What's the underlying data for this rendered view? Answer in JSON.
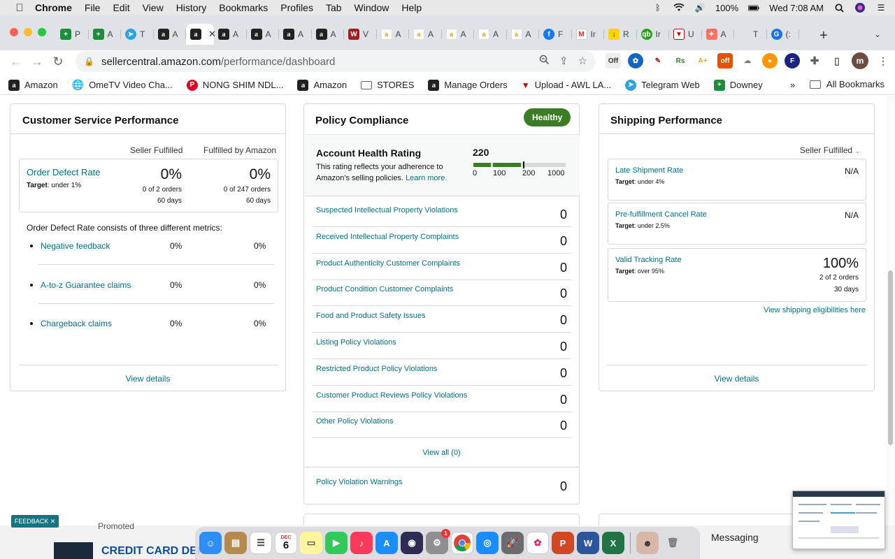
{
  "menubar": {
    "apple": "",
    "items": [
      "Chrome",
      "File",
      "Edit",
      "View",
      "History",
      "Bookmarks",
      "Profiles",
      "Tab",
      "Window",
      "Help"
    ],
    "battery": "100%",
    "clock": "Wed 7:08 AM"
  },
  "tabs": [
    {
      "icon": "google-sheets-icon",
      "label": "P",
      "glyph": "+"
    },
    {
      "icon": "google-sheets-icon",
      "label": "A",
      "glyph": "+"
    },
    {
      "icon": "telegram-icon",
      "label": "T",
      "glyph": "➤"
    },
    {
      "icon": "amazon-icon",
      "label": "A",
      "glyph": "a"
    },
    {
      "icon": "amazon-icon",
      "label": "",
      "glyph": "a",
      "active": true
    },
    {
      "icon": "amazon-icon",
      "label": "A",
      "glyph": "a"
    },
    {
      "icon": "amazon-icon",
      "label": "A",
      "glyph": "a"
    },
    {
      "icon": "amazon-icon",
      "label": "A",
      "glyph": "a"
    },
    {
      "icon": "amazon-icon",
      "label": "A",
      "glyph": "a"
    },
    {
      "icon": "w-icon",
      "label": "V",
      "glyph": "W"
    },
    {
      "icon": "amazon-smile-icon",
      "label": "A",
      "glyph": "a"
    },
    {
      "icon": "amazon-smile-icon",
      "label": "A",
      "glyph": "a"
    },
    {
      "icon": "amazon-smile-icon",
      "label": "A",
      "glyph": "a"
    },
    {
      "icon": "amazon-smile-icon",
      "label": "A",
      "glyph": "a"
    },
    {
      "icon": "amazon-smile-icon",
      "label": "A",
      "glyph": "a"
    },
    {
      "icon": "facebook-icon",
      "label": "F",
      "glyph": "f"
    },
    {
      "icon": "gmail-icon",
      "label": "Ir",
      "glyph": "M"
    },
    {
      "icon": "download-icon",
      "label": "R",
      "glyph": "↓"
    },
    {
      "icon": "quickbooks-icon",
      "label": "Ir",
      "glyph": "qb"
    },
    {
      "icon": "awl-icon",
      "label": "U",
      "glyph": "▼"
    },
    {
      "icon": "figma-icon",
      "label": "A",
      "glyph": "✦"
    },
    {
      "icon": "blank-icon",
      "label": "T",
      "glyph": ""
    },
    {
      "icon": "grammarly-icon",
      "label": "(:",
      "glyph": "G"
    }
  ],
  "url": {
    "host": "sellercentral.amazon.com",
    "path": "/performance/dashboard"
  },
  "bookmarks": [
    {
      "icon": "amazon-icon",
      "label": "Amazon"
    },
    {
      "icon": "globe-icon",
      "label": "OmeTV Video Cha..."
    },
    {
      "icon": "pinterest-icon",
      "label": "NONG SHIM NDL..."
    },
    {
      "icon": "amazon-icon",
      "label": "Amazon"
    },
    {
      "icon": "folder-icon",
      "label": "STORES"
    },
    {
      "icon": "amazon-icon",
      "label": "Manage Orders"
    },
    {
      "icon": "awl-icon",
      "label": "Upload - AWL LA..."
    },
    {
      "icon": "telegram-icon",
      "label": "Telegram Web"
    },
    {
      "icon": "google-sheets-icon",
      "label": "Downey"
    }
  ],
  "bookmarks_more": "»",
  "all_bookmarks": "All Bookmarks",
  "profile_initial": "m",
  "customer_service": {
    "title": "Customer Service Performance",
    "col1": "Seller Fulfilled",
    "col2": "Fulfilled by Amazon",
    "odr_label": "Order Defect Rate",
    "odr_target_prefix": "Target",
    "odr_target": ": under 1%",
    "sf_value": "0%",
    "sf_orders": "0 of 2 orders",
    "sf_days": "60 days",
    "fba_value": "0%",
    "fba_orders": "0 of 247 orders",
    "fba_days": "60 days",
    "metrics_intro": "Order Defect Rate consists of three different metrics:",
    "metrics": [
      {
        "label": "Negative feedback",
        "sf": "0%",
        "fba": "0%"
      },
      {
        "label": "A-to-z Guarantee claims",
        "sf": "0%",
        "fba": "0%"
      },
      {
        "label": "Chargeback claims",
        "sf": "0%",
        "fba": "0%"
      }
    ],
    "view_details": "View details"
  },
  "policy": {
    "title": "Policy Compliance",
    "status": "Healthy",
    "ahr_title": "Account Health Rating",
    "ahr_desc1": "This rating reflects your adherence to",
    "ahr_desc2": "Amazon's selling policies.",
    "learn_more": "Learn more.",
    "ahr_value": "220",
    "scale": [
      "0",
      "100",
      "200",
      "1000"
    ],
    "rows": [
      {
        "label": "Suspected Intellectual Property Violations",
        "value": "0"
      },
      {
        "label": "Received Intellectual Property Complaints",
        "value": "0"
      },
      {
        "label": "Product Authenticity Customer Complaints",
        "value": "0"
      },
      {
        "label": "Product Condition Customer Complaints",
        "value": "0"
      },
      {
        "label": "Food and Product Safety Issues",
        "value": "0"
      },
      {
        "label": "Listing Policy Violations",
        "value": "0"
      },
      {
        "label": "Restricted Product Policy Violations",
        "value": "0"
      },
      {
        "label": "Customer Product Reviews Policy Violations",
        "value": "0"
      },
      {
        "label": "Other Policy Violations",
        "value": "0"
      }
    ],
    "view_all": "View all (0)",
    "warnings_label": "Policy Violation Warnings",
    "warnings_value": "0"
  },
  "shipping": {
    "title": "Shipping Performance",
    "dropdown": "Seller Fulfilled",
    "items": [
      {
        "label": "Late Shipment Rate",
        "target_prefix": "Target",
        "target": ": under 4%",
        "value": "N/A"
      },
      {
        "label": "Pre-fulfillment Cancel Rate",
        "target_prefix": "Target",
        "target": ": under 2.5%",
        "value": "N/A"
      }
    ],
    "vtr": {
      "label": "Valid Tracking Rate",
      "target_prefix": "Target",
      "target": ": over 95%",
      "value": "100%",
      "orders": "2 of 2 orders",
      "days": "30 days"
    },
    "eligibilities": "View shipping eligibilities here",
    "view_details": "View details"
  },
  "feedback": "FEEDBACK",
  "bottom": {
    "promoted": "Promoted",
    "ad_text": "CREDIT CARD DEI"
  },
  "dock": {
    "messaging": "Messaging",
    "calendar_month": "DEC",
    "calendar_day": "6",
    "badge": "1"
  },
  "colors": {
    "link": "#007185",
    "healthy": "#3a7d25",
    "border": "#d5d9d9"
  }
}
